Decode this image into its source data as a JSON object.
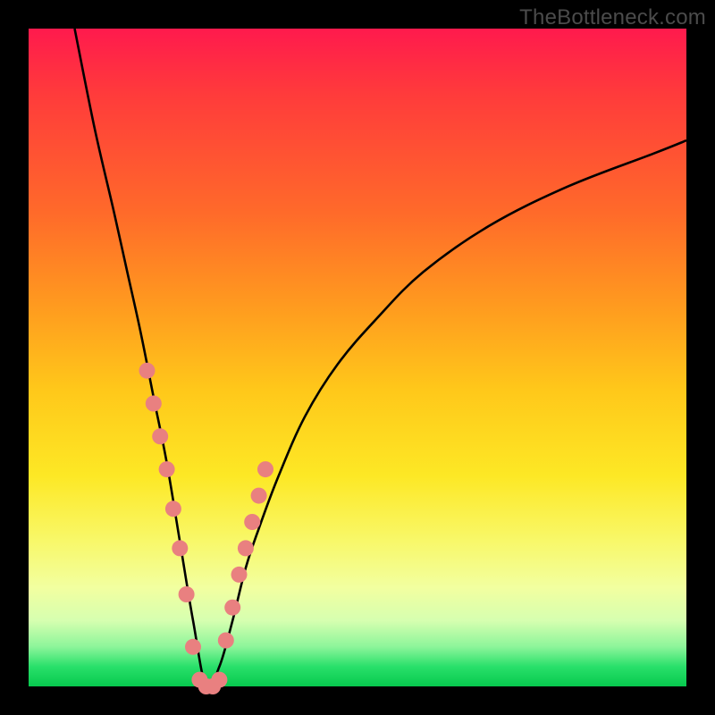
{
  "watermark": "TheBottleneck.com",
  "colors": {
    "background": "#000000",
    "curve": "#000000",
    "marker_fill": "#e98080",
    "marker_stroke": "#d96e6e"
  },
  "chart_data": {
    "type": "line",
    "title": "",
    "xlabel": "",
    "ylabel": "",
    "xlim": [
      0,
      100
    ],
    "ylim": [
      0,
      100
    ],
    "grid": false,
    "legend": false,
    "curve": {
      "note": "Black V-shaped curve; minimum at x≈27, y≈0 (bottom of plot). Left branch is steep; right branch curves out toward the top-right edge. y represents bottleneck percentage.",
      "x": [
        7,
        10,
        13,
        15,
        17,
        19,
        21,
        23,
        25,
        27,
        29,
        31,
        33,
        35,
        38,
        42,
        47,
        53,
        60,
        70,
        82,
        95,
        100
      ],
      "y": [
        100,
        85,
        72,
        63,
        54,
        44,
        34,
        22,
        10,
        0,
        3,
        10,
        18,
        24,
        32,
        41,
        49,
        56,
        63,
        70,
        76,
        81,
        83
      ]
    },
    "markers": {
      "note": "Salmon/pink circular markers placed along the lower part of the curve; denser near the minimum with a short flat cluster at the bottom.",
      "x": [
        18,
        19,
        20,
        21,
        22,
        23,
        24,
        25,
        26,
        27,
        28,
        29,
        30,
        31,
        32,
        33,
        34,
        35,
        36
      ],
      "y": [
        48,
        43,
        38,
        33,
        27,
        21,
        14,
        6,
        1,
        0,
        0,
        1,
        7,
        12,
        17,
        21,
        25,
        29,
        33
      ]
    }
  }
}
